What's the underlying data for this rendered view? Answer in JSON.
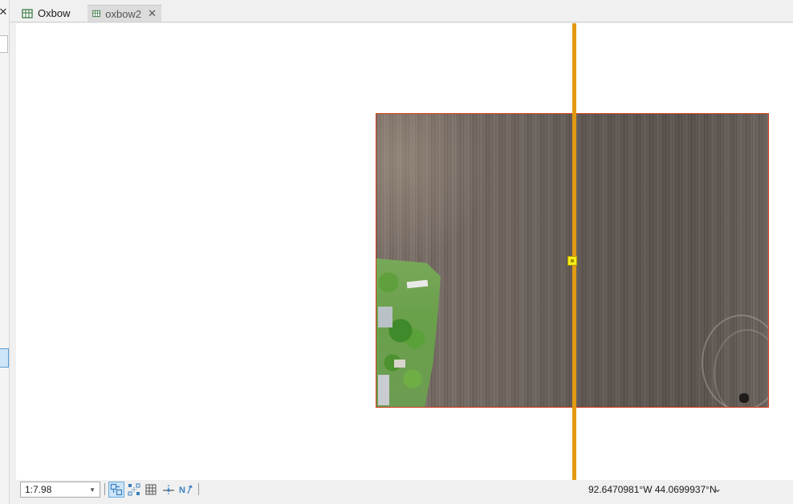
{
  "tabs": [
    {
      "label": "Oxbow",
      "active": false,
      "closable": false,
      "icon": "map-icon"
    },
    {
      "label": "oxbow2",
      "active": true,
      "closable": true,
      "icon": "map-icon"
    }
  ],
  "left_pane": {
    "close_glyph": "✕"
  },
  "status": {
    "scale": "1:7.98",
    "coordinates": "92.6470981°W 44.0699937°N",
    "tools": [
      "snapping-icon",
      "select-vertices-icon",
      "grid-icon",
      "constraint-icon",
      "north-arrow-icon"
    ]
  },
  "colors": {
    "accent": "#6aaad9",
    "line": "#e39a11",
    "vertex": "#f5ef1a",
    "raster_outline": "#d23a1a"
  }
}
